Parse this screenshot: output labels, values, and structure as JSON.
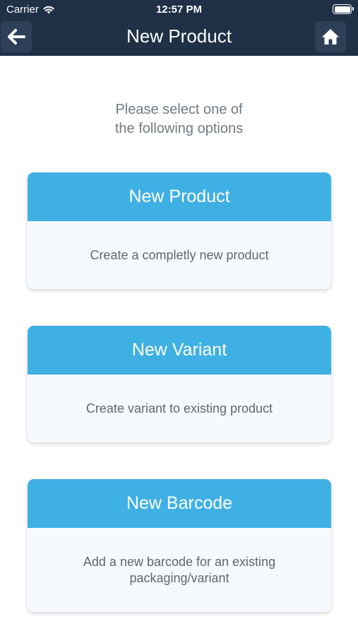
{
  "status": {
    "carrier": "Carrier",
    "time": "12:57 PM"
  },
  "nav": {
    "title": "New Product"
  },
  "prompt": "Please select one of\nthe following options",
  "options": [
    {
      "title": "New Product",
      "description": "Create a completly new product"
    },
    {
      "title": "New Variant",
      "description": "Create variant to existing product"
    },
    {
      "title": "New Barcode",
      "description": "Add a new barcode for an existing\npackaging/variant"
    }
  ],
  "colors": {
    "nav_bar": "#1f3047",
    "card_header": "#3fb0e4",
    "card_body": "#f6fafe"
  },
  "icons": {
    "back": "arrow-left-icon",
    "home": "home-icon"
  }
}
